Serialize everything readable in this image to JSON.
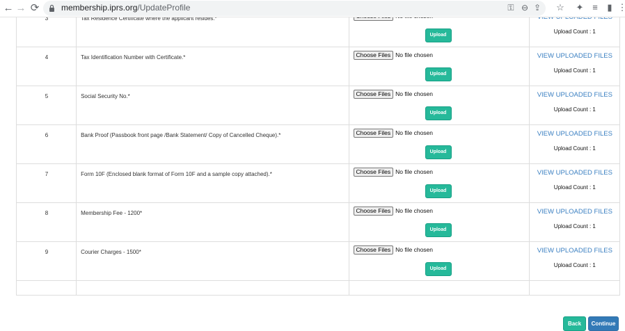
{
  "browser": {
    "back_icon": "←",
    "forward_icon": "→",
    "reload_icon": "⟳",
    "url_domain": "membership.iprs.org",
    "url_path": "/UpdateProfile",
    "key_icon": "⚿",
    "zoom_icon": "⊖",
    "share_icon": "⇪",
    "star_icon": "☆",
    "extensions_icon": "✦",
    "media_icon": "≡",
    "sidebar_icon": "▮",
    "menu_icon": "⋮"
  },
  "file_input": {
    "button_label": "Choose Files",
    "status": "No file chosen"
  },
  "labels": {
    "upload": "Upload",
    "view_uploaded": "VIEW UPLOADED FILES"
  },
  "rows": [
    {
      "num": "3",
      "desc": "Tax Residence Certificate where the applicant resides.*",
      "count": "Upload Count : 1"
    },
    {
      "num": "4",
      "desc": "Tax Identification Number with Certificate.*",
      "count": "Upload Count : 1"
    },
    {
      "num": "5",
      "desc": "Social Security No.*",
      "count": "Upload Count : 1"
    },
    {
      "num": "6",
      "desc": "Bank Proof (Passbook front page /Bank Statement/ Copy of Cancelled Cheque).*",
      "count": "Upload Count : 1"
    },
    {
      "num": "7",
      "desc": "Form 10F (Enclosed blank format of Form 10F and a sample copy attached).*",
      "count": "Upload Count : 1"
    },
    {
      "num": "8",
      "desc": "Membership Fee - 1200*",
      "count": "Upload Count : 1"
    },
    {
      "num": "9",
      "desc": "Courier Charges - 1500*",
      "count": "Upload Count : 1"
    }
  ],
  "footer": {
    "back_label": "Back",
    "continue_label": "Continue"
  },
  "colors": {
    "upload_button": "#26b99a",
    "continue_button": "#337ab7",
    "link": "#3a7fc1"
  }
}
